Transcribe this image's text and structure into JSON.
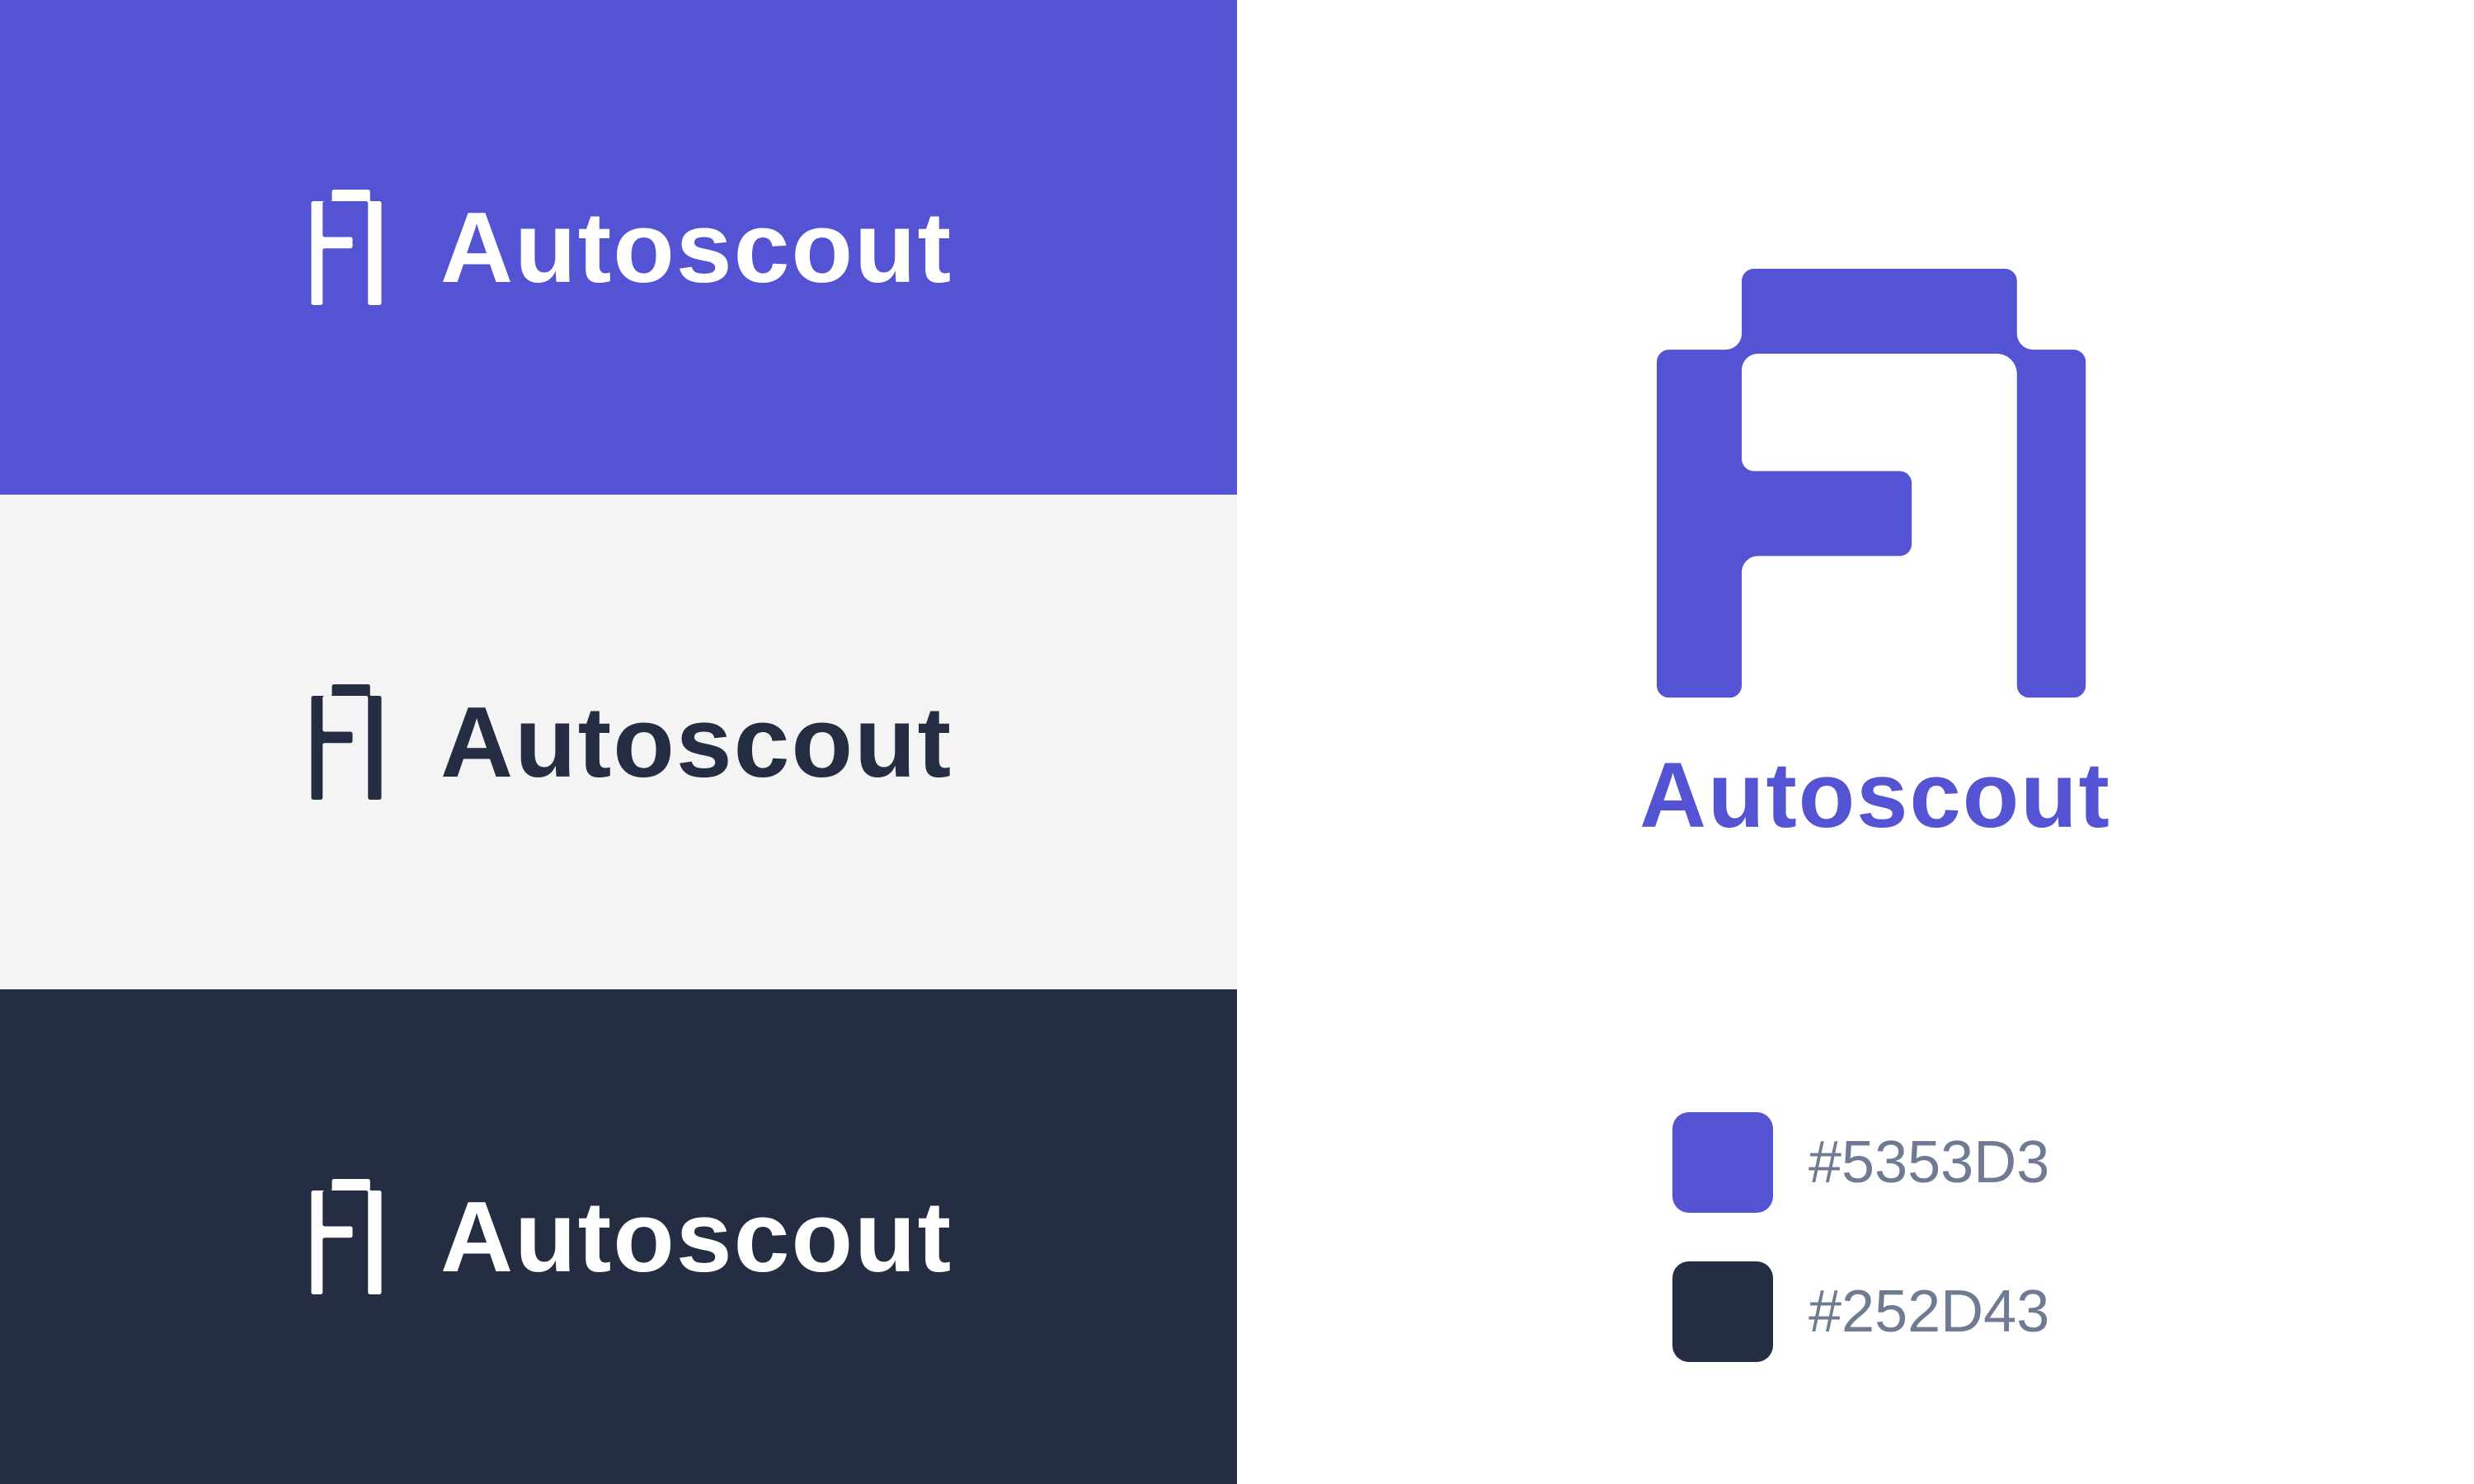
{
  "brand": {
    "name": "Autoscout"
  },
  "colors": {
    "primary": "#5353D3",
    "dark": "#252D43",
    "light_bg": "#F4F4F4",
    "white": "#FFFFFF",
    "label_gray": "#6E7B92"
  },
  "panels": [
    {
      "id": "primary",
      "background": "#5353D3",
      "foreground": "#FFFFFF",
      "wordmark": "Autoscout",
      "icon": "autoscout-logo-icon"
    },
    {
      "id": "light",
      "background": "#F4F4F4",
      "foreground": "#252D43",
      "wordmark": "Autoscout",
      "icon": "autoscout-logo-icon"
    },
    {
      "id": "dark",
      "background": "#252D43",
      "foreground": "#FFFFFF",
      "wordmark": "Autoscout",
      "icon": "autoscout-logo-icon"
    }
  ],
  "hero": {
    "wordmark": "Autoscout",
    "color": "#5353D3",
    "icon": "autoscout-logo-icon"
  },
  "swatches": [
    {
      "hex": "#5353D3",
      "label": "#5353D3"
    },
    {
      "hex": "#252D43",
      "label": "#252D43"
    }
  ]
}
